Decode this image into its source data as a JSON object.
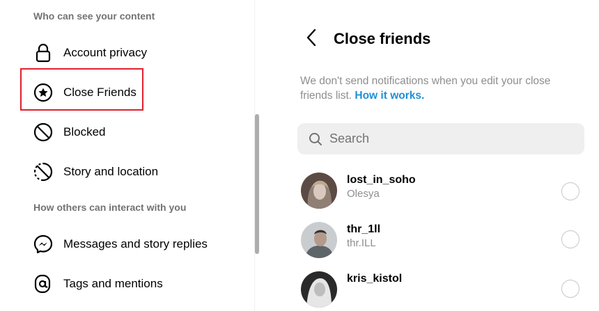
{
  "sidebar": {
    "section1": "Who can see your content",
    "items1": [
      {
        "label": "Account privacy",
        "icon": "lock-icon"
      },
      {
        "label": "Close Friends",
        "icon": "star-circle-icon"
      },
      {
        "label": "Blocked",
        "icon": "blocked-icon"
      },
      {
        "label": "Story and location",
        "icon": "story-location-icon"
      }
    ],
    "section2": "How others can interact with you",
    "items2": [
      {
        "label": "Messages and story replies",
        "icon": "messenger-icon"
      },
      {
        "label": "Tags and mentions",
        "icon": "at-icon"
      }
    ]
  },
  "main": {
    "title": "Close friends",
    "note_text": "We don't send notifications when you edit your close friends list. ",
    "note_link": "How it works.",
    "search_placeholder": "Search",
    "friends": [
      {
        "username": "lost_in_soho",
        "name": "Olesya"
      },
      {
        "username": "thr_1ll",
        "name": "thr.ILL"
      },
      {
        "username": "kris_kistol",
        "name": ""
      }
    ]
  },
  "colors": {
    "highlight": "#e0202d",
    "link": "#1e90d6",
    "muted": "#8e8e8e"
  }
}
